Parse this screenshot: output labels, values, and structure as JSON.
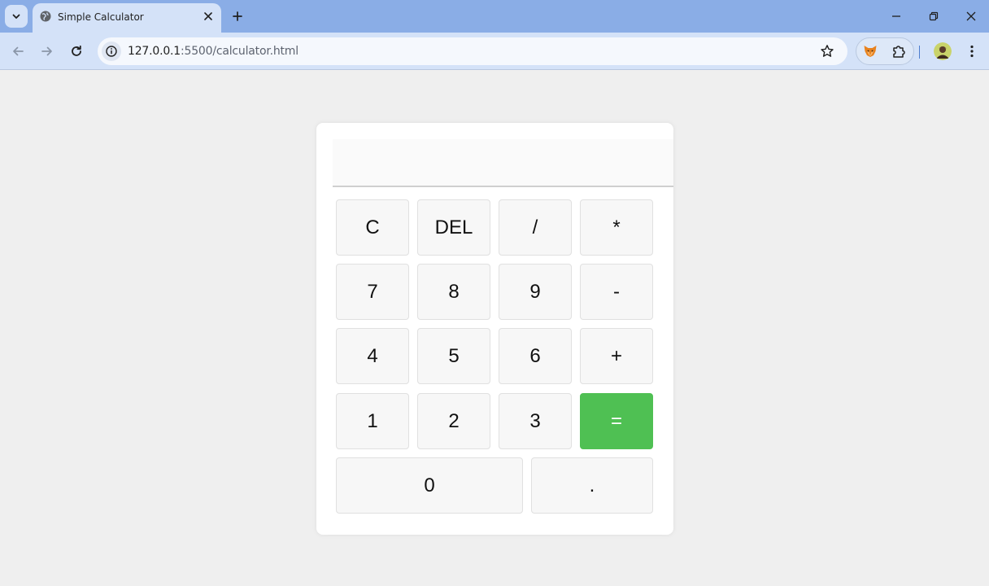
{
  "browser": {
    "tab_title": "Simple Calculator",
    "url_host": "127.0.0.1",
    "url_path": ":5500/calculator.html"
  },
  "calculator": {
    "display_value": "",
    "keys": {
      "clear": "C",
      "delete": "DEL",
      "divide": "/",
      "multiply": "*",
      "seven": "7",
      "eight": "8",
      "nine": "9",
      "subtract": "-",
      "four": "4",
      "five": "5",
      "six": "6",
      "add": "+",
      "one": "1",
      "two": "2",
      "three": "3",
      "equals": "=",
      "zero": "0",
      "decimal": "."
    },
    "equals_color": "#4fc053"
  },
  "icons": {
    "tab_search": "chevron-down-icon",
    "favicon": "globe-icon",
    "tab_close": "close-icon",
    "new_tab": "plus-icon",
    "back": "back-arrow-icon",
    "forward": "forward-arrow-icon",
    "reload": "reload-icon",
    "site_info": "info-icon",
    "bookmark": "star-icon",
    "extension_fox": "fox-icon",
    "extensions": "puzzle-icon",
    "profile": "avatar",
    "menu": "kebab-menu-icon",
    "minimize": "minimize-icon",
    "restore": "restore-icon",
    "close_window": "close-window-icon"
  }
}
